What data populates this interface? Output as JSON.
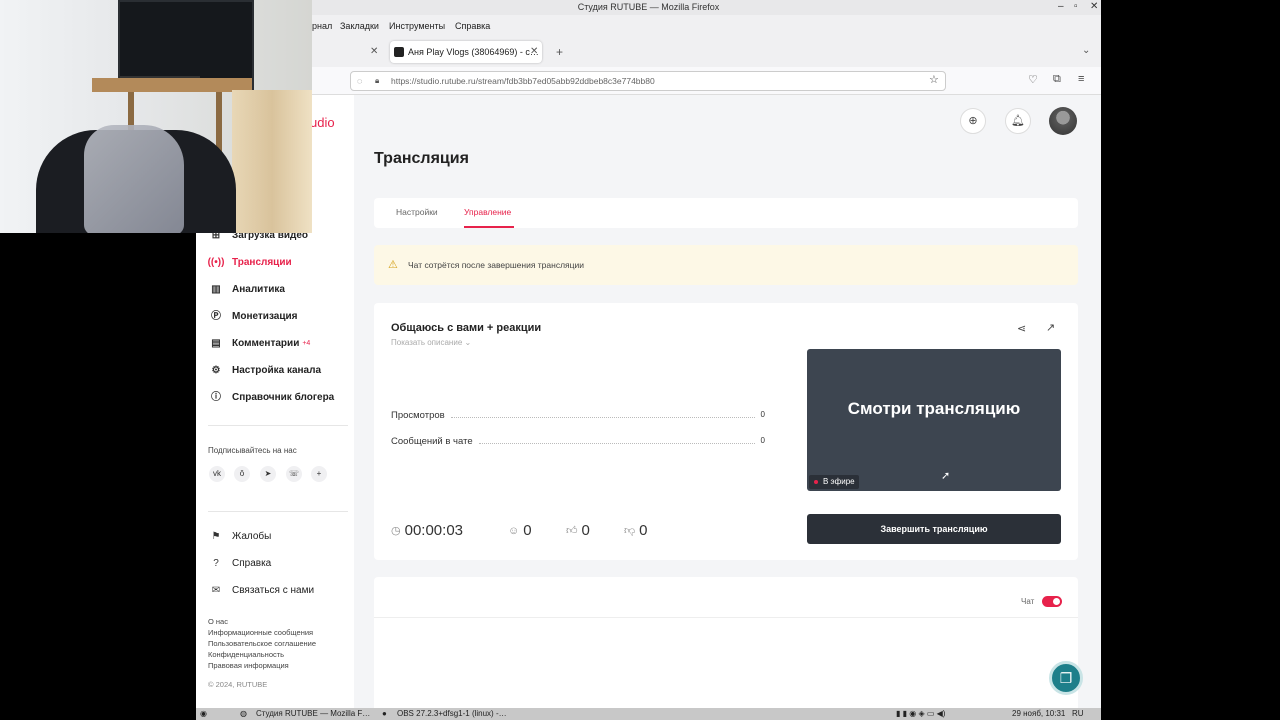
{
  "window": {
    "title": "Студия RUTUBE — Mozilla Firefox",
    "controls": [
      "–",
      "▫",
      "✕"
    ]
  },
  "menubar": [
    "рнал",
    "Закладки",
    "Инструменты",
    "Справка"
  ],
  "tabs": [
    {
      "label": "",
      "active": false
    },
    {
      "label": "Аня Play Vlogs (38064969) - с…",
      "active": true
    }
  ],
  "url": "https://studio.rutube.ru/stream/fdb3bb7ed05abb92ddbeb8c3e774bb80",
  "logo_text": "udio",
  "sidebar": {
    "items": [
      {
        "label": "Загрузка видео",
        "icon": "upload-icon",
        "active": false
      },
      {
        "label": "Трансляции",
        "icon": "broadcast-icon",
        "active": true
      },
      {
        "label": "Аналитика",
        "icon": "chart-icon",
        "active": false
      },
      {
        "label": "Монетизация",
        "icon": "ruble-icon",
        "active": false
      },
      {
        "label": "Комментарии",
        "icon": "comment-icon",
        "active": false,
        "badge": "+4"
      },
      {
        "label": "Настройка канала",
        "icon": "gear-icon",
        "active": false
      },
      {
        "label": "Справочник блогера",
        "icon": "info-icon",
        "active": false
      }
    ],
    "subscribe_label": "Подписывайтесь на нас",
    "socials": [
      "vk",
      "ok",
      "telegram",
      "viber",
      "+"
    ],
    "bottom_items": [
      {
        "label": "Жалобы",
        "icon": "flag-icon"
      },
      {
        "label": "Справка",
        "icon": "help-icon"
      },
      {
        "label": "Связаться с нами",
        "icon": "mail-icon"
      }
    ],
    "footer_links": [
      "О нас",
      "Информационные сообщения",
      "Пользовательское соглашение",
      "Конфиденциальность",
      "Правовая информация"
    ],
    "copyright": "© 2024, RUTUBE"
  },
  "main": {
    "title": "Трансляция",
    "tabs": [
      "Настройки",
      "Управление"
    ],
    "active_tab": "Управление",
    "warning": "Чат сотрётся после завершения трансляции",
    "stream": {
      "title": "Общаюсь с вами + реакции",
      "show_description": "Показать описание ⌄",
      "stats": [
        {
          "label": "Просмотров",
          "value": "0"
        },
        {
          "label": "Сообщений в чате",
          "value": "0"
        }
      ],
      "preview_text": "Смотри трансляцию",
      "live_label": "В эфире",
      "end_button": "Завершить трансляцию",
      "metrics": {
        "duration": "00:00:03",
        "viewers": "0",
        "likes": "0",
        "dislikes": "0"
      }
    },
    "chat_label": "Чат",
    "chat_enabled": true
  },
  "taskbar": {
    "items": [
      "Студия RUTUBE — Mozilla F…",
      "OBS 27.2.3+dfsg1-1 (linux) -…"
    ],
    "clock": "29 нояб, 10:31",
    "lang": "RU"
  },
  "colors": {
    "accent": "#e7224b",
    "dark_button": "#2b3038",
    "fab": "#1e7f8a"
  }
}
